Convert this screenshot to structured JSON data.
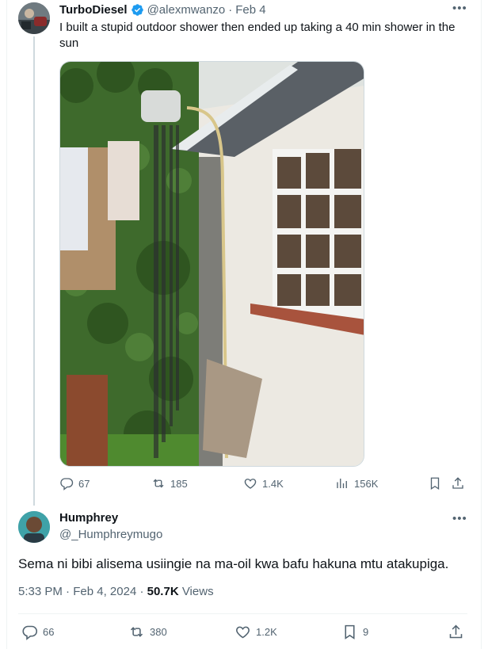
{
  "parent": {
    "display_name": "TurboDiesel",
    "handle": "@alexmwanzo",
    "separator": "·",
    "date": "Feb 4",
    "text": "I built a stupid outdoor shower then ended up taking a 40 min shower in the sun",
    "more_icon": "more-horizontal-icon",
    "stats": {
      "replies": "67",
      "reposts": "185",
      "likes": "1.4K",
      "views": "156K"
    }
  },
  "reply": {
    "display_name": "Humphrey",
    "handle": "@_Humphreymugo",
    "text": "Sema ni bibi alisema usiingie na ma-oil kwa bafu hakuna mtu atakupiga.",
    "time": "5:33 PM",
    "dot": "·",
    "date": "Feb 4, 2024",
    "view_count": "50.7K",
    "views_label": "Views",
    "stats": {
      "replies": "66",
      "reposts": "380",
      "likes": "1.2K",
      "bookmarks": "9"
    }
  },
  "colors": {
    "text": "#0f1419",
    "muted": "#536471",
    "verified": "#1d9bf0",
    "border": "#eff3f4"
  }
}
